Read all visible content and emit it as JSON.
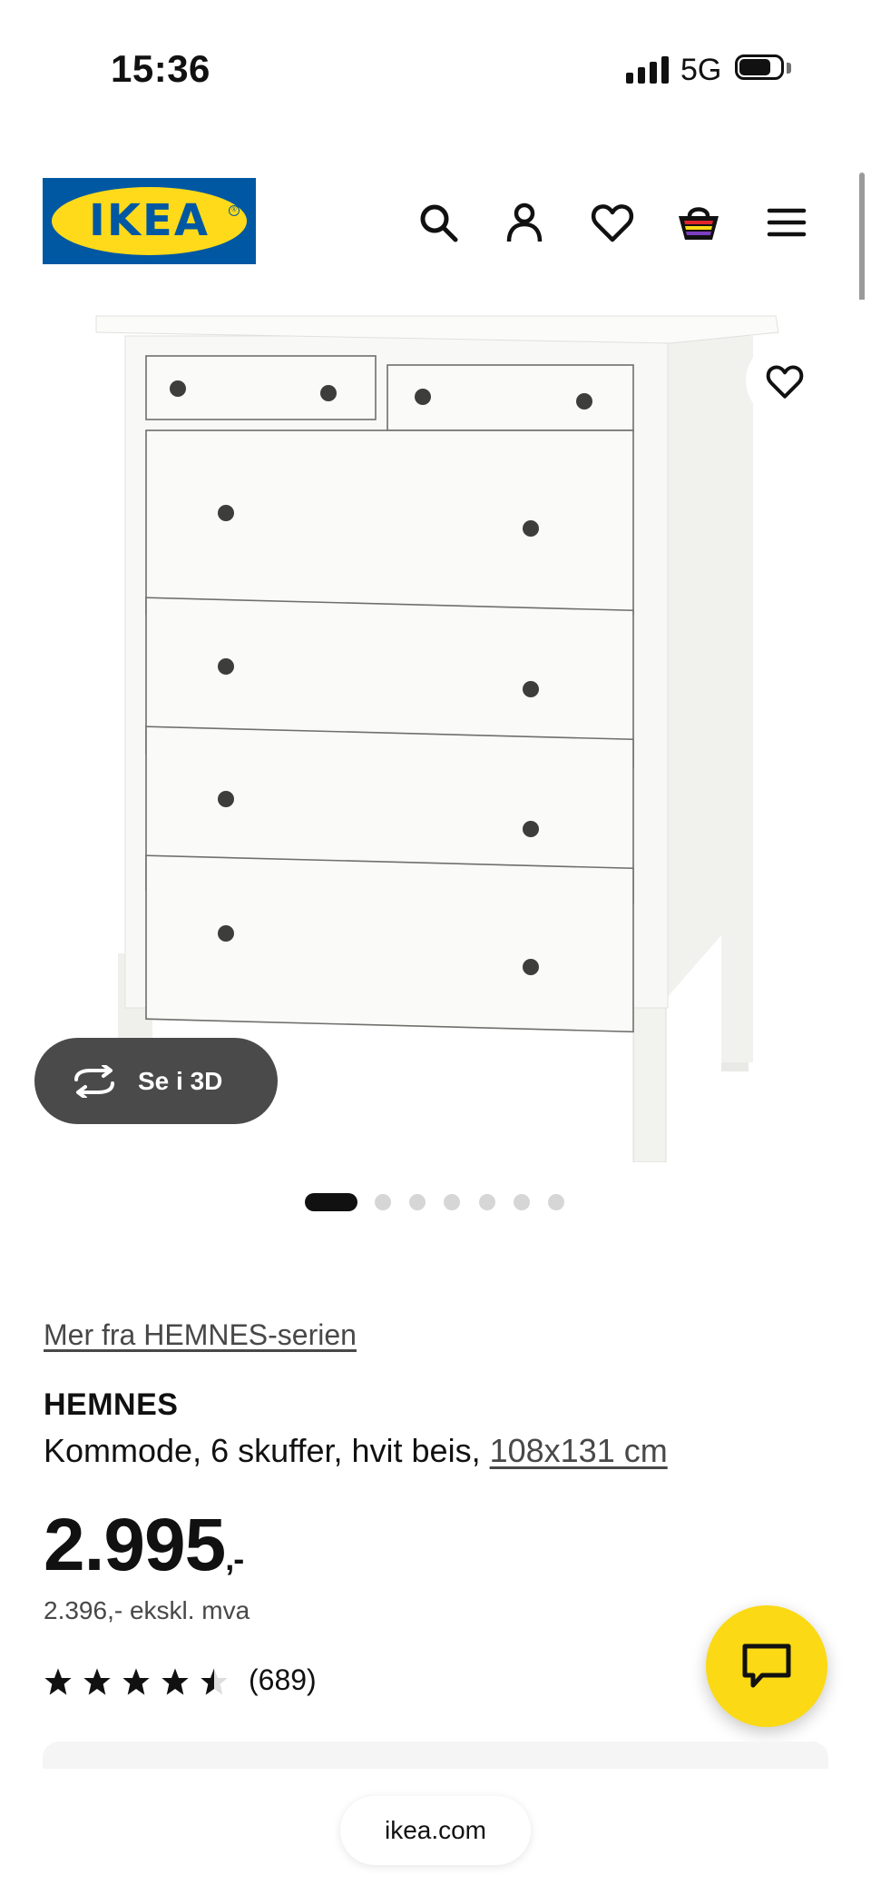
{
  "status_bar": {
    "time": "15:36",
    "network": "5G",
    "signal_bars": 4,
    "battery_level": 0.75
  },
  "header": {
    "logo_text": "IKEA",
    "logo_registered": "®",
    "icons": [
      "search-icon",
      "user-icon",
      "heart-icon",
      "basket-icon",
      "menu-icon"
    ]
  },
  "product_image": {
    "view_3d_label": "Se i 3D",
    "carousel_total": 7,
    "carousel_active": 1
  },
  "product": {
    "series_link": "Mer fra HEMNES-serien",
    "name": "HEMNES",
    "description": "Kommode, 6 skuffer, hvit beis,",
    "size": "108x131 cm",
    "price": "2.995",
    "price_suffix": ",-",
    "price_ex_vat": "2.396,- ekskl. mva",
    "rating_value": 4.5,
    "rating_max": 5,
    "rating_count": "(689)"
  },
  "browser": {
    "url": "ikea.com"
  },
  "colors": {
    "brand_blue": "#0058a3",
    "brand_yellow": "#ffda1a",
    "chat_yellow": "#fbd914",
    "button_3d": "#4a4a4a"
  }
}
